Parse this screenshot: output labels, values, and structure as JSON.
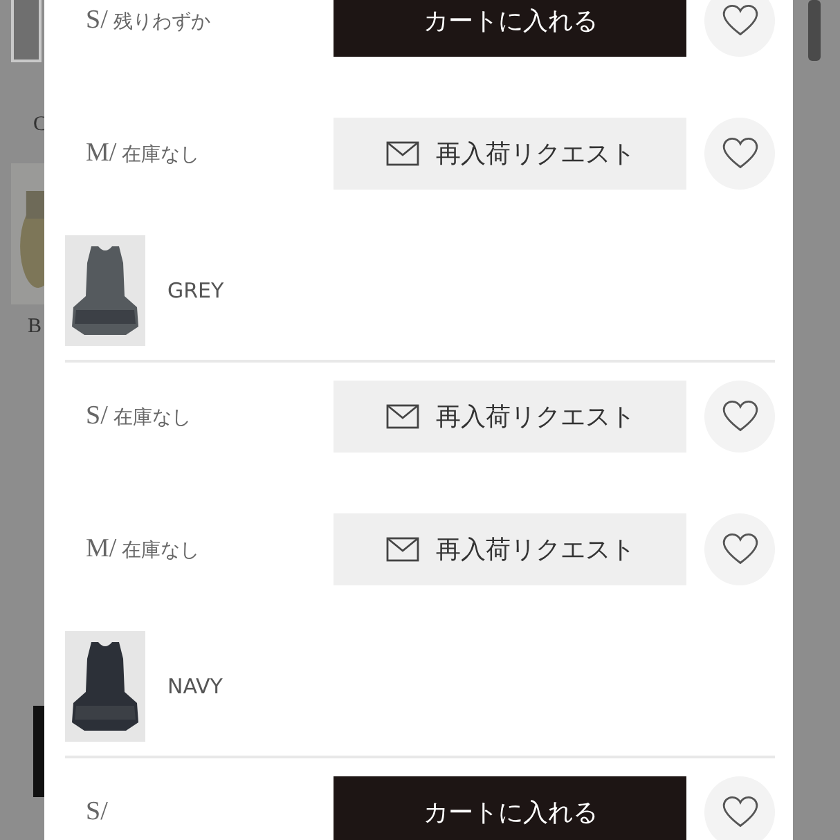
{
  "background": {
    "labels": [
      "C",
      "B"
    ]
  },
  "variants": [
    {
      "sizes": [
        {
          "size": "S/",
          "status": "残りわずか",
          "action": {
            "kind": "cart",
            "label": "カートに入れる"
          }
        },
        {
          "size": "M/",
          "status": "在庫なし",
          "action": {
            "kind": "restock",
            "label": "再入荷リクエスト"
          }
        }
      ]
    },
    {
      "name": "GREY",
      "image": {
        "kind": "picture"
      },
      "sizes": [
        {
          "size": "S/",
          "status": "在庫なし",
          "action": {
            "kind": "restock",
            "label": "再入荷リクエスト"
          }
        },
        {
          "size": "M/",
          "status": "在庫なし",
          "action": {
            "kind": "restock",
            "label": "再入荷リクエスト"
          }
        }
      ]
    },
    {
      "name": "NAVY",
      "image": {
        "kind": "picture"
      },
      "sizes": [
        {
          "size": "S/",
          "action": {
            "kind": "cart",
            "label": "カートに入れる"
          }
        }
      ]
    }
  ]
}
